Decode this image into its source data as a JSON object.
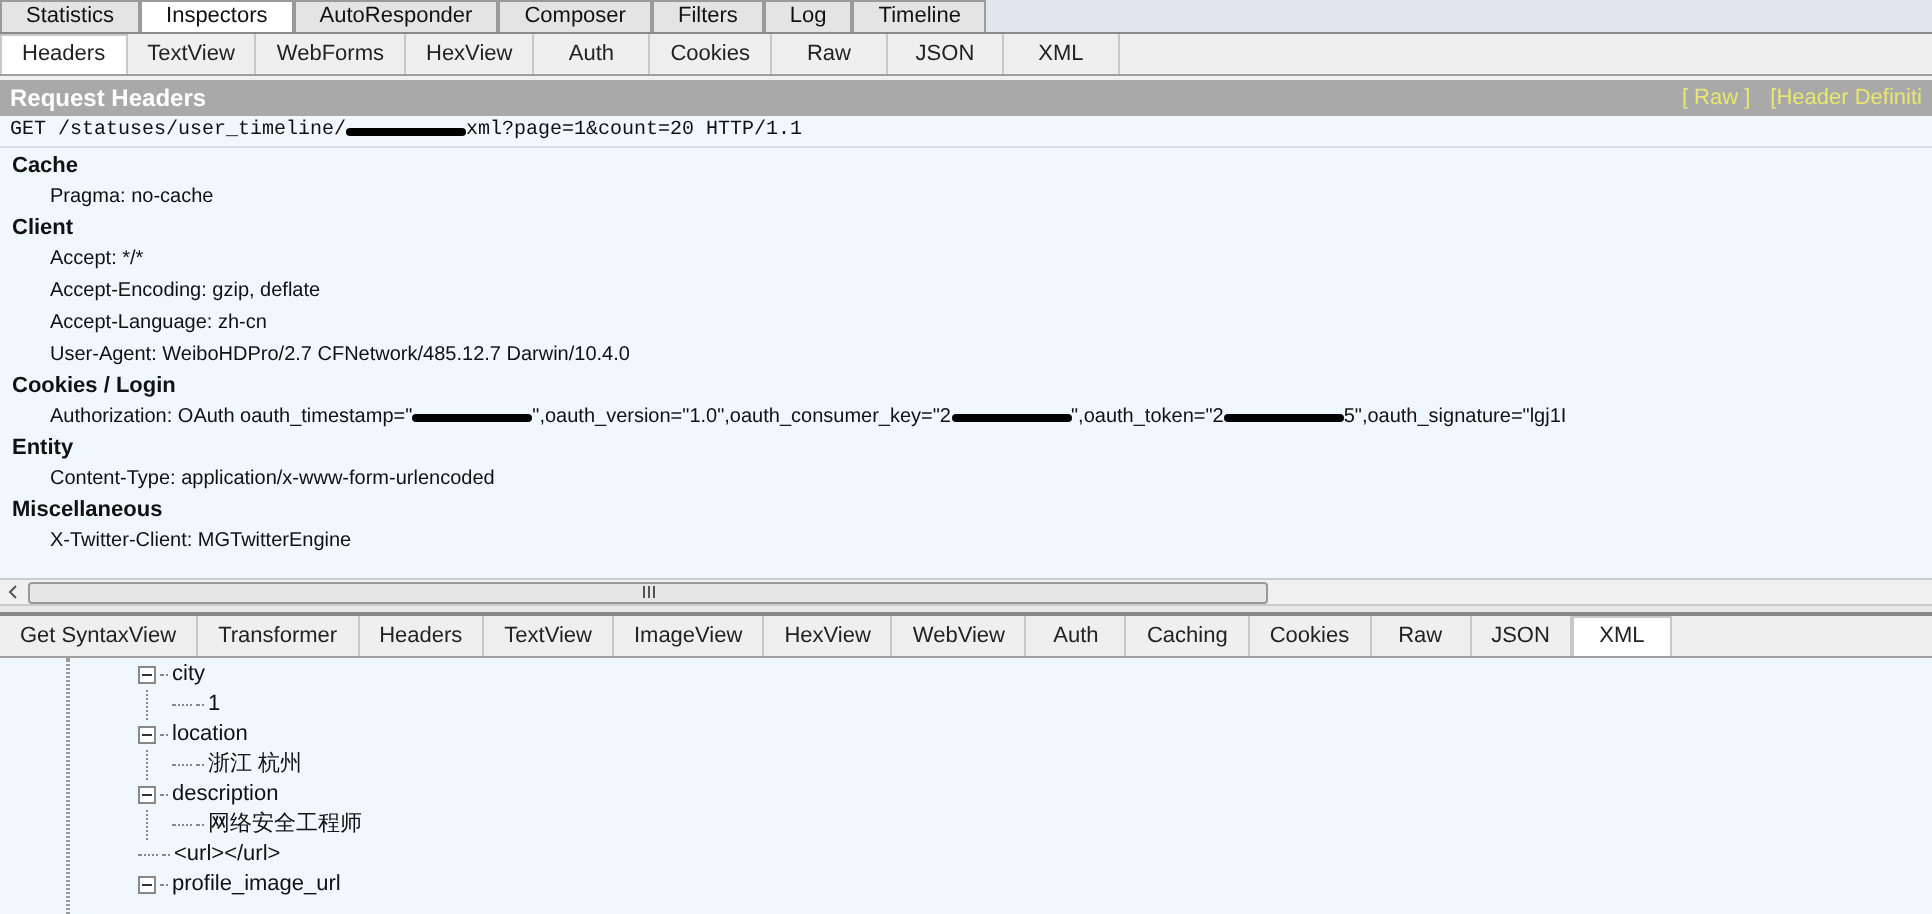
{
  "main_tabs": [
    {
      "label": "Statistics",
      "selected": false
    },
    {
      "label": "Inspectors",
      "selected": true
    },
    {
      "label": "AutoResponder",
      "selected": false
    },
    {
      "label": "Composer",
      "selected": false
    },
    {
      "label": "Filters",
      "selected": false
    },
    {
      "label": "Log",
      "selected": false
    },
    {
      "label": "Timeline",
      "selected": false
    }
  ],
  "request_tabs": [
    {
      "label": "Headers",
      "selected": true
    },
    {
      "label": "TextView",
      "selected": false
    },
    {
      "label": "WebForms",
      "selected": false
    },
    {
      "label": "HexView",
      "selected": false
    },
    {
      "label": "Auth",
      "selected": false
    },
    {
      "label": "Cookies",
      "selected": false
    },
    {
      "label": "Raw",
      "selected": false
    },
    {
      "label": "JSON",
      "selected": false
    },
    {
      "label": "XML",
      "selected": false
    }
  ],
  "request_headers": {
    "title": "Request Headers",
    "links": [
      "[ Raw ]",
      "[Header Definiti"
    ],
    "request_line": [
      {
        "kind": "text",
        "text": "GET /statuses/user_timeline/"
      },
      {
        "kind": "redacted"
      },
      {
        "kind": "text",
        "text": "xml?page=1&count=20 HTTP/1.1"
      }
    ],
    "groups": [
      {
        "name": "Cache",
        "headers": [
          [
            {
              "kind": "text",
              "text": "Pragma: no-cache"
            }
          ]
        ]
      },
      {
        "name": "Client",
        "headers": [
          [
            {
              "kind": "text",
              "text": "Accept: */*"
            }
          ],
          [
            {
              "kind": "text",
              "text": "Accept-Encoding: gzip, deflate"
            }
          ],
          [
            {
              "kind": "text",
              "text": "Accept-Language: zh-cn"
            }
          ],
          [
            {
              "kind": "text",
              "text": "User-Agent: WeiboHDPro/2.7 CFNetwork/485.12.7 Darwin/10.4.0"
            }
          ]
        ]
      },
      {
        "name": "Cookies / Login",
        "headers": [
          [
            {
              "kind": "text",
              "text": "Authorization: OAuth oauth_timestamp=\""
            },
            {
              "kind": "redacted"
            },
            {
              "kind": "text",
              "text": "\",oauth_version=\"1.0\",oauth_consumer_key=\"2"
            },
            {
              "kind": "redacted"
            },
            {
              "kind": "text",
              "text": "\",oauth_token=\"2"
            },
            {
              "kind": "redacted"
            },
            {
              "kind": "text",
              "text": "5\",oauth_signature=\"lgj1I"
            }
          ]
        ]
      },
      {
        "name": "Entity",
        "headers": [
          [
            {
              "kind": "text",
              "text": "Content-Type: application/x-www-form-urlencoded"
            }
          ]
        ]
      },
      {
        "name": "Miscellaneous",
        "headers": [
          [
            {
              "kind": "text",
              "text": "X-Twitter-Client: MGTwitterEngine"
            }
          ]
        ]
      }
    ]
  },
  "response_tabs": [
    {
      "label": "Get SyntaxView",
      "selected": false
    },
    {
      "label": "Transformer",
      "selected": false
    },
    {
      "label": "Headers",
      "selected": false
    },
    {
      "label": "TextView",
      "selected": false
    },
    {
      "label": "ImageView",
      "selected": false
    },
    {
      "label": "HexView",
      "selected": false
    },
    {
      "label": "WebView",
      "selected": false
    },
    {
      "label": "Auth",
      "selected": false
    },
    {
      "label": "Caching",
      "selected": false
    },
    {
      "label": "Cookies",
      "selected": false
    },
    {
      "label": "Raw",
      "selected": false
    },
    {
      "label": "JSON",
      "selected": false
    },
    {
      "label": "XML",
      "selected": true
    }
  ],
  "xml_tree": [
    {
      "label": "city",
      "expanded": true,
      "children": [
        {
          "label": "1"
        }
      ]
    },
    {
      "label": "location",
      "expanded": true,
      "children": [
        {
          "label": "浙江 杭州"
        }
      ]
    },
    {
      "label": "description",
      "expanded": true,
      "children": [
        {
          "label": "网络安全工程师"
        }
      ]
    },
    {
      "label": "<url></url>"
    },
    {
      "label": "profile_image_url",
      "expanded": true
    }
  ]
}
